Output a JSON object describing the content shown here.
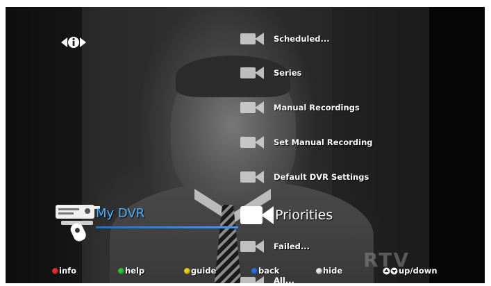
{
  "screen": {
    "section_title": "My DVR",
    "accent_color": "#4fb3ff",
    "watermark": "RTV"
  },
  "menu": {
    "items": [
      {
        "label": "Scheduled...",
        "icon": "video-camera-icon"
      },
      {
        "label": "Series",
        "icon": "video-camera-icon"
      },
      {
        "label": "Manual Recordings",
        "icon": "video-camera-icon"
      },
      {
        "label": "Set Manual Recording",
        "icon": "video-camera-icon"
      },
      {
        "label": "Default DVR Settings",
        "icon": "video-camera-icon"
      },
      {
        "label": "Priorities",
        "icon": "video-camera-icon",
        "selected": true
      },
      {
        "label": "Failed...",
        "icon": "video-camera-icon"
      },
      {
        "label": "All...",
        "icon": "video-camera-icon"
      }
    ]
  },
  "footer": {
    "hints": [
      {
        "label": "info",
        "color": "#e03030"
      },
      {
        "label": "help",
        "color": "#2fc43a"
      },
      {
        "label": "guide",
        "color": "#e8d21a"
      },
      {
        "label": "back",
        "color": "#2f6fe0"
      },
      {
        "label": "hide",
        "color": "#e8e8e8"
      },
      {
        "label": "up/down",
        "color": "#ffffff"
      }
    ]
  }
}
